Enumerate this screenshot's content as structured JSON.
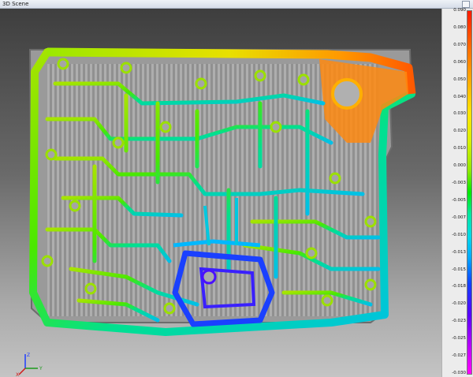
{
  "window": {
    "title": "3D Scene"
  },
  "scale": {
    "labels": [
      "0.090",
      "0.080",
      "0.070",
      "0.060",
      "0.050",
      "0.040",
      "0.030",
      "0.020",
      "0.010",
      "0.000",
      "-0.003",
      "-0.005",
      "-0.007",
      "-0.010",
      "-0.013",
      "-0.015",
      "-0.018",
      "-0.020",
      "-0.023",
      "-0.025",
      "-0.027",
      "-0.030"
    ],
    "colors": [
      "#ff1a00",
      "#ff6a00",
      "#ffe400",
      "#00e800",
      "#00a8ff",
      "#1040ff",
      "#ff00ff"
    ]
  },
  "axes": {
    "x": "X",
    "y": "Y",
    "z": "Z"
  },
  "icons": {
    "pin": "pin-icon",
    "axes": "axis-triad-icon"
  }
}
